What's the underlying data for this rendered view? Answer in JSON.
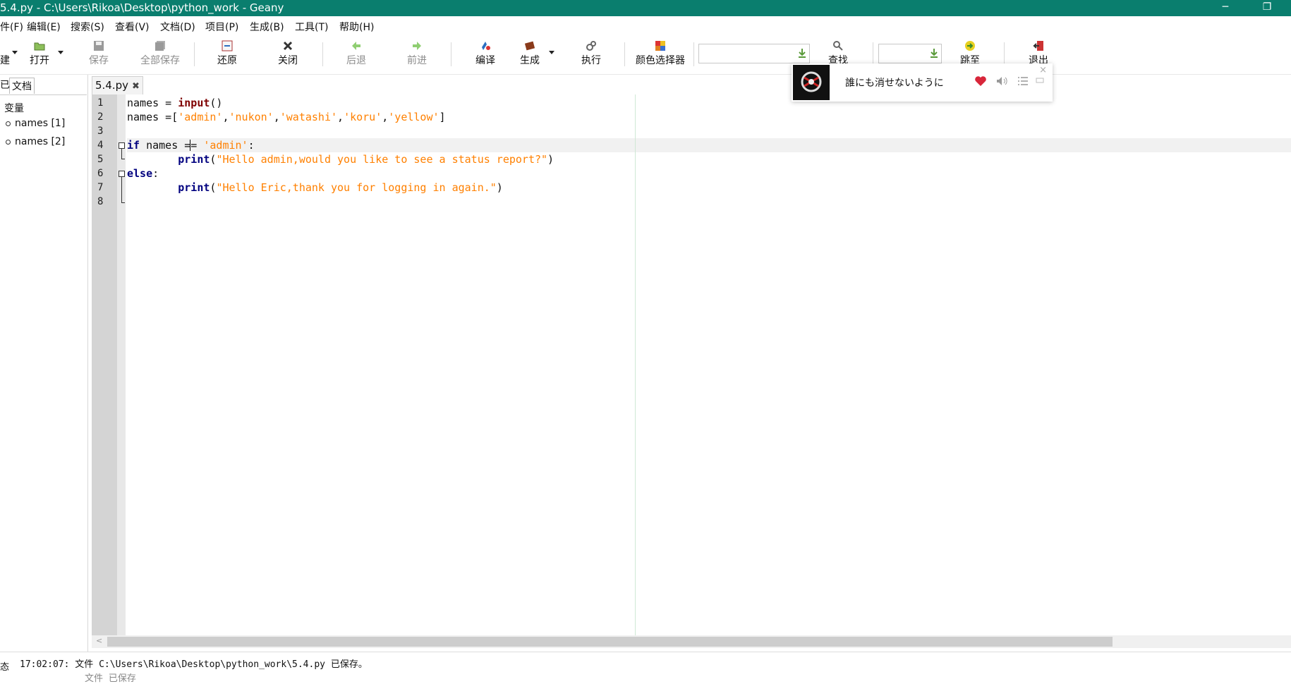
{
  "window": {
    "title": "5.4.py - C:\\Users\\Rikoa\\Desktop\\python_work - Geany",
    "minimize_icon": "minimize-icon",
    "restore_icon": "restore-icon"
  },
  "menu": [
    {
      "label": "件(F)"
    },
    {
      "label": "编辑(E)"
    },
    {
      "label": "搜索(S)"
    },
    {
      "label": "查看(V)"
    },
    {
      "label": "文档(D)"
    },
    {
      "label": "项目(P)"
    },
    {
      "label": "生成(B)"
    },
    {
      "label": "工具(T)"
    },
    {
      "label": "帮助(H)"
    }
  ],
  "toolbar": {
    "new_label": "建",
    "open_label": "打开",
    "save_label": "保存",
    "save_all_label": "全部保存",
    "revert_label": "还原",
    "close_label": "关闭",
    "back_label": "后退",
    "forward_label": "前进",
    "compile_label": "编译",
    "build_label": "生成",
    "run_label": "执行",
    "color_label": "颜色选择器",
    "find_label": "查找",
    "goto_label": "跳至",
    "quit_label": "退出",
    "search_value": "",
    "goto_value": ""
  },
  "sidebar": {
    "tabs": [
      "已",
      "文档"
    ],
    "header": "变量",
    "symbols": [
      "names [1]",
      "names [2]"
    ]
  },
  "editor": {
    "tab_label": "5.4.py",
    "tab_close": "✖",
    "line_numbers": [
      "1",
      "2",
      "3",
      "4",
      "5",
      "6",
      "7",
      "8"
    ],
    "lines": {
      "l1_a": "names = ",
      "l1_fn": "input",
      "l1_b": "()",
      "l2_a": "names =[",
      "l2_s1": "'admin'",
      "l2_s2": "'nukon'",
      "l2_s3": "'watashi'",
      "l2_s4": "'koru'",
      "l2_s5": "'yellow'",
      "l2_b": "]",
      "comma": ",",
      "l4_kw": "if",
      "l4_a": " names ",
      "l4_op": "== ",
      "l4_s": "'admin'",
      "l4_b": ":",
      "l5_indent": "        ",
      "l5_fn": "print",
      "l5_s": "\"Hello admin,would you like to see a status report?\"",
      "paren_open": "(",
      "paren_close": ")",
      "l6_kw": "else",
      "l6_b": ":",
      "l7_indent": "        ",
      "l7_fn": "print",
      "l7_s": "\"Hello Eric,thank you for logging in again.\""
    }
  },
  "status": {
    "label": "态",
    "message": "17:02:07: 文件 C:\\Users\\Rikoa\\Desktop\\python_work\\5.4.py 已保存。",
    "message2": "文件                                              已保存"
  },
  "music_popup": {
    "song": "誰にも消せないように",
    "icons": [
      "heart-icon",
      "volume-icon",
      "playlist-icon",
      "mini-icon"
    ],
    "close": "×"
  },
  "colors": {
    "titlebar": "#0a7e6e",
    "keyword": "#00007f",
    "function": "#7f0000",
    "string": "#ff8000"
  }
}
